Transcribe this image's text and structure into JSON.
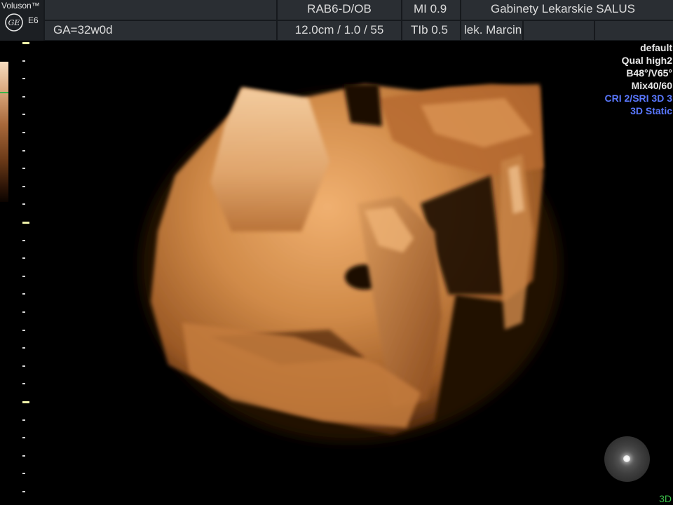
{
  "header": {
    "brand": "Voluson™",
    "model": "E6",
    "probe": "RAB6-D/OB",
    "mechanical_index": "MI  0.9",
    "institution": "Gabinety Lekarskie SALUS",
    "gestational_age": "GA=32w0d",
    "depth_info": "12.0cm / 1.0 / 55",
    "thermal_index": "TIb  0.5",
    "operator": "lek. Marcin"
  },
  "params": {
    "preset": "default",
    "quality": "Qual high2",
    "angles": "B48°/V65°",
    "mix": "Mix40/60",
    "filters": "CRI 2/SRI 3D 3",
    "mode_label": "3D Static"
  },
  "mode_indicator": "3D",
  "colors": {
    "accent_blue": "#5a78ff",
    "accent_green": "#3bbf4a",
    "render_tint": "#c7783a"
  },
  "icons": {
    "logo": "ge-logo-icon",
    "trackball": "trackball-icon"
  }
}
